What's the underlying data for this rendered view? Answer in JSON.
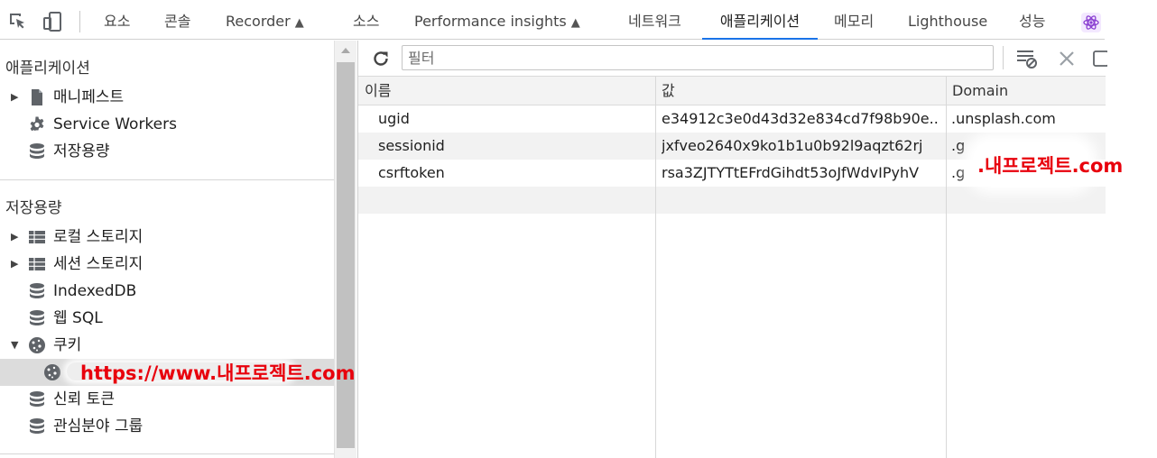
{
  "tabs": [
    {
      "label": "요소"
    },
    {
      "label": "콘솔"
    },
    {
      "label": "Recorder",
      "beaker": "▲"
    },
    {
      "label": "소스"
    },
    {
      "label": "Performance insights",
      "beaker": "▲"
    },
    {
      "label": "네트워크"
    },
    {
      "label": "애플리케이션",
      "active": true
    },
    {
      "label": "메모리"
    },
    {
      "label": "Lighthouse"
    },
    {
      "label": "성능"
    }
  ],
  "sidebar": {
    "app_section": "애플리케이션",
    "app_items": [
      {
        "label": "매니페스트",
        "icon": "document-icon",
        "expandable": true
      },
      {
        "label": "Service Workers",
        "icon": "gear-icon",
        "expandable": false
      },
      {
        "label": "저장용량",
        "icon": "database-icon",
        "expandable": false
      }
    ],
    "storage_section": "저장용량",
    "storage_items": [
      {
        "label": "로컬 스토리지",
        "icon": "grid-icon",
        "expandable": true
      },
      {
        "label": "세션 스토리지",
        "icon": "grid-icon",
        "expandable": true
      },
      {
        "label": "IndexedDB",
        "icon": "database-icon",
        "expandable": false
      },
      {
        "label": "웹 SQL",
        "icon": "database-icon",
        "expandable": false
      },
      {
        "label": "쿠키",
        "icon": "cookie-icon",
        "expandable": true,
        "expanded": true
      },
      {
        "label": "",
        "icon": "cookie-icon",
        "selected": true
      },
      {
        "label": "신뢰 토큰",
        "icon": "database-icon",
        "expandable": false
      },
      {
        "label": "관심분야 그룹",
        "icon": "database-icon",
        "expandable": false
      }
    ]
  },
  "toolbar": {
    "filter_placeholder": "필터"
  },
  "table": {
    "headers": [
      "이름",
      "값",
      "Domain"
    ],
    "rows": [
      {
        "name": "ugid",
        "value": "e34912c3e0d43d32e834cd7f98b90e...",
        "domain": ".unsplash.com"
      },
      {
        "name": "sessionid",
        "value": "jxfveo2640x9ko1b1u0b92l9aqzt62rj",
        "domain": ".g"
      },
      {
        "name": "csrftoken",
        "value": "rsa3ZJTYTtEFrdGihdt53oJfWdvIPyhV",
        "domain": ".g"
      }
    ]
  },
  "overlays": {
    "sidebar_url": "https://www.내프로젝트.com",
    "domain_watermark": ".내프로젝트.com",
    "color": "#e8000c"
  }
}
